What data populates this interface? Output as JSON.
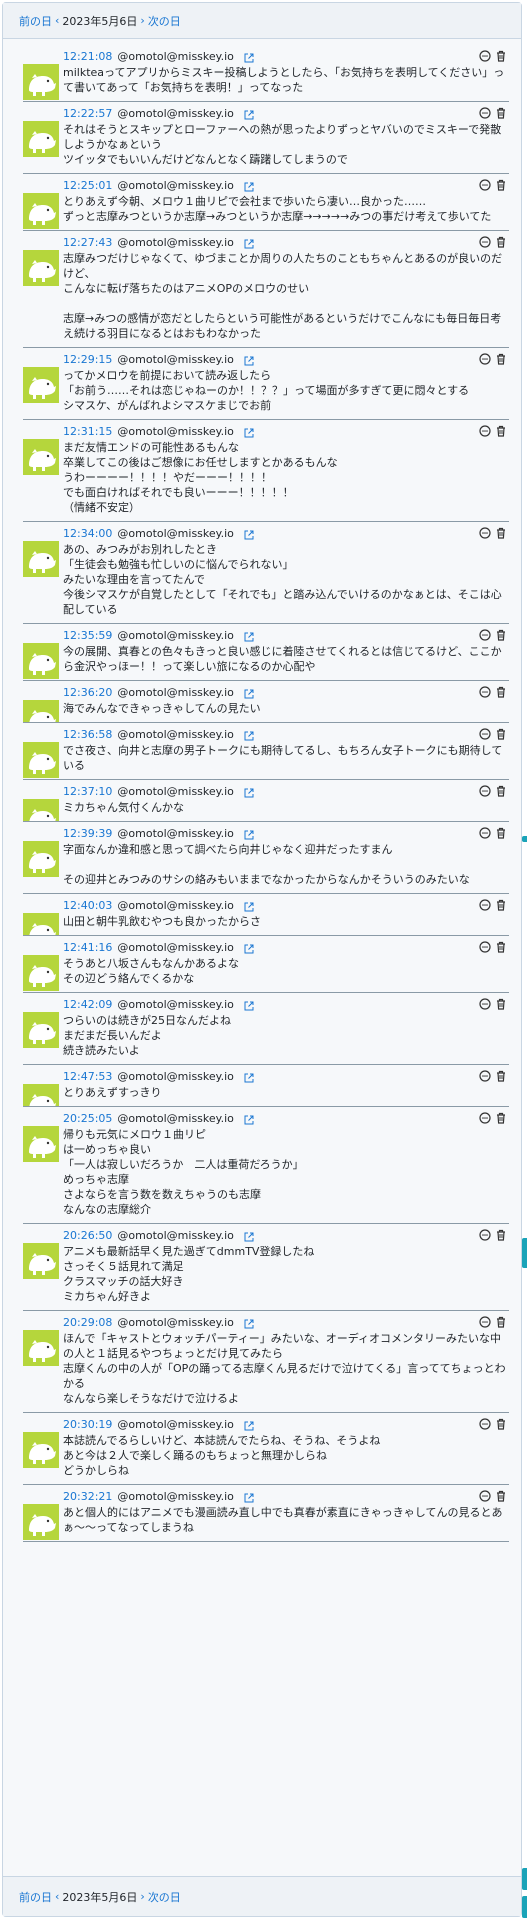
{
  "nav": {
    "prev": "前の日",
    "date": "2023年5月6日",
    "next": "次の日"
  },
  "notes": [
    {
      "time": "12:21:08",
      "user": "@omotol@misskey.io",
      "text": "milkteaってアプリからミスキー投稿しようとしたら、「お気持ちを表明してください」って書いてあって「お気持ちを表明！」ってなった"
    },
    {
      "time": "12:22:57",
      "user": "@omotol@misskey.io",
      "text": "それはそうとスキップとローファーへの熱が思ったよりずっとヤバいのでミスキーで発散しようかなぁという\nツイッタでもいいんだけどなんとなく躊躇してしまうので"
    },
    {
      "time": "12:25:01",
      "user": "@omotol@misskey.io",
      "text": "とりあえず今朝、メロウ１曲リピで会社まで歩いたら凄い…良かった……\nずっと志摩みつというか志摩→みつというか志摩→→→→→みつの事だけ考えて歩いてた"
    },
    {
      "time": "12:27:43",
      "user": "@omotol@misskey.io",
      "text": "志摩みつだけじゃなくて、ゆづまことか周りの人たちのこともちゃんとあるのが良いのだけど、\nこんなに転げ落ちたのはアニメOPのメロウのせい\n\n志摩→みつの感情が恋だとしたらという可能性があるというだけでこんなにも毎日毎日考え続ける羽目になるとはおもわなかった"
    },
    {
      "time": "12:29:15",
      "user": "@omotol@misskey.io",
      "text": "ってかメロウを前提において読み返したら\n「お前う……それは恋じゃねーのか！！？？」って場面が多すぎて更に悶々とする\nシマスケ、がんばれよシマスケまじでお前"
    },
    {
      "time": "12:31:15",
      "user": "@omotol@misskey.io",
      "text": "まだ友情エンドの可能性あるもんな\n卒業してこの後はご想像にお任せしますとかあるもんな\nうわーーーー！！！！やだーーー！！！！\nでも面白ければそれでも良いーーー！！！！！\n（情緒不安定）"
    },
    {
      "time": "12:34:00",
      "user": "@omotol@misskey.io",
      "text": "あの、みつみがお別れしたとき\n「生徒会も勉強も忙しいのに悩んでられない」\nみたいな理由を言ってたんで\n今後シマスケが自覚したとして「それでも」と踏み込んでいけるのかなぁとは、そこは心配している"
    },
    {
      "time": "12:35:59",
      "user": "@omotol@misskey.io",
      "text": "今の展開、真春との色々もきっと良い感じに着陸させてくれるとは信じてるけど、ここから金沢やっほー！！って楽しい旅になるのか心配や"
    },
    {
      "time": "12:36:20",
      "user": "@omotol@misskey.io",
      "text": "海でみんなできゃっきゃしてんの見たい"
    },
    {
      "time": "12:36:58",
      "user": "@omotol@misskey.io",
      "text": "でさ夜さ、向井と志摩の男子トークにも期待してるし、もちろん女子トークにも期待している"
    },
    {
      "time": "12:37:10",
      "user": "@omotol@misskey.io",
      "text": "ミカちゃん気付くんかな"
    },
    {
      "time": "12:39:39",
      "user": "@omotol@misskey.io",
      "text": "字面なんか違和感と思って調べたら向井じゃなく迎井だったすまん\n\nその迎井とみつみのサシの絡みもいままでなかったからなんかそういうのみたいな"
    },
    {
      "time": "12:40:03",
      "user": "@omotol@misskey.io",
      "text": "山田と朝牛乳飲むやつも良かったからさ"
    },
    {
      "time": "12:41:16",
      "user": "@omotol@misskey.io",
      "text": "そうあと八坂さんもなんかあるよな\nその辺どう絡んでくるかな"
    },
    {
      "time": "12:42:09",
      "user": "@omotol@misskey.io",
      "text": "つらいのは続きが25日なんだよね\nまだまだ長いんだよ\n続き読みたいよ"
    },
    {
      "time": "12:47:53",
      "user": "@omotol@misskey.io",
      "text": "とりあえずすっきり"
    },
    {
      "time": "20:25:05",
      "user": "@omotol@misskey.io",
      "text": "帰りも元気にメロウ１曲リピ\nは一めっちゃ良い\n「一人は寂しいだろうか　二人は重荷だろうか」\nめっちゃ志摩\nさよならを言う数を数えちゃうのも志摩\nなんなの志摩総介"
    },
    {
      "time": "20:26:50",
      "user": "@omotol@misskey.io",
      "text": "アニメも最新話早く見た過ぎてdmmTV登録したね\nさっそく５話見れて満足\nクラスマッチの話大好き\nミカちゃん好きよ"
    },
    {
      "time": "20:29:08",
      "user": "@omotol@misskey.io",
      "text": "ほんで「キャストとウォッチパーティー」みたいな、オーディオコメンタリーみたいな中の人と１話見るやつちょっとだけ見てみたら\n志摩くんの中の人が「OPの踊ってる志摩くん見るだけで泣けてくる」言っててちょっとわかる\nなんなら楽しそうなだけで泣けるよ"
    },
    {
      "time": "20:30:19",
      "user": "@omotol@misskey.io",
      "text": "本誌読んでるらしいけど、本誌読んでたらね、そうね、そうよね\nあと今は２人で楽しく踊るのもちょっと無理かしらね\nどうかしらね"
    },
    {
      "time": "20:32:21",
      "user": "@omotol@misskey.io",
      "text": "あと個人的にはアニメでも漫画読み直し中でも真春が素直にきゃっきゃしてんの見るとあぁ〜〜ってなってしまうね"
    }
  ]
}
